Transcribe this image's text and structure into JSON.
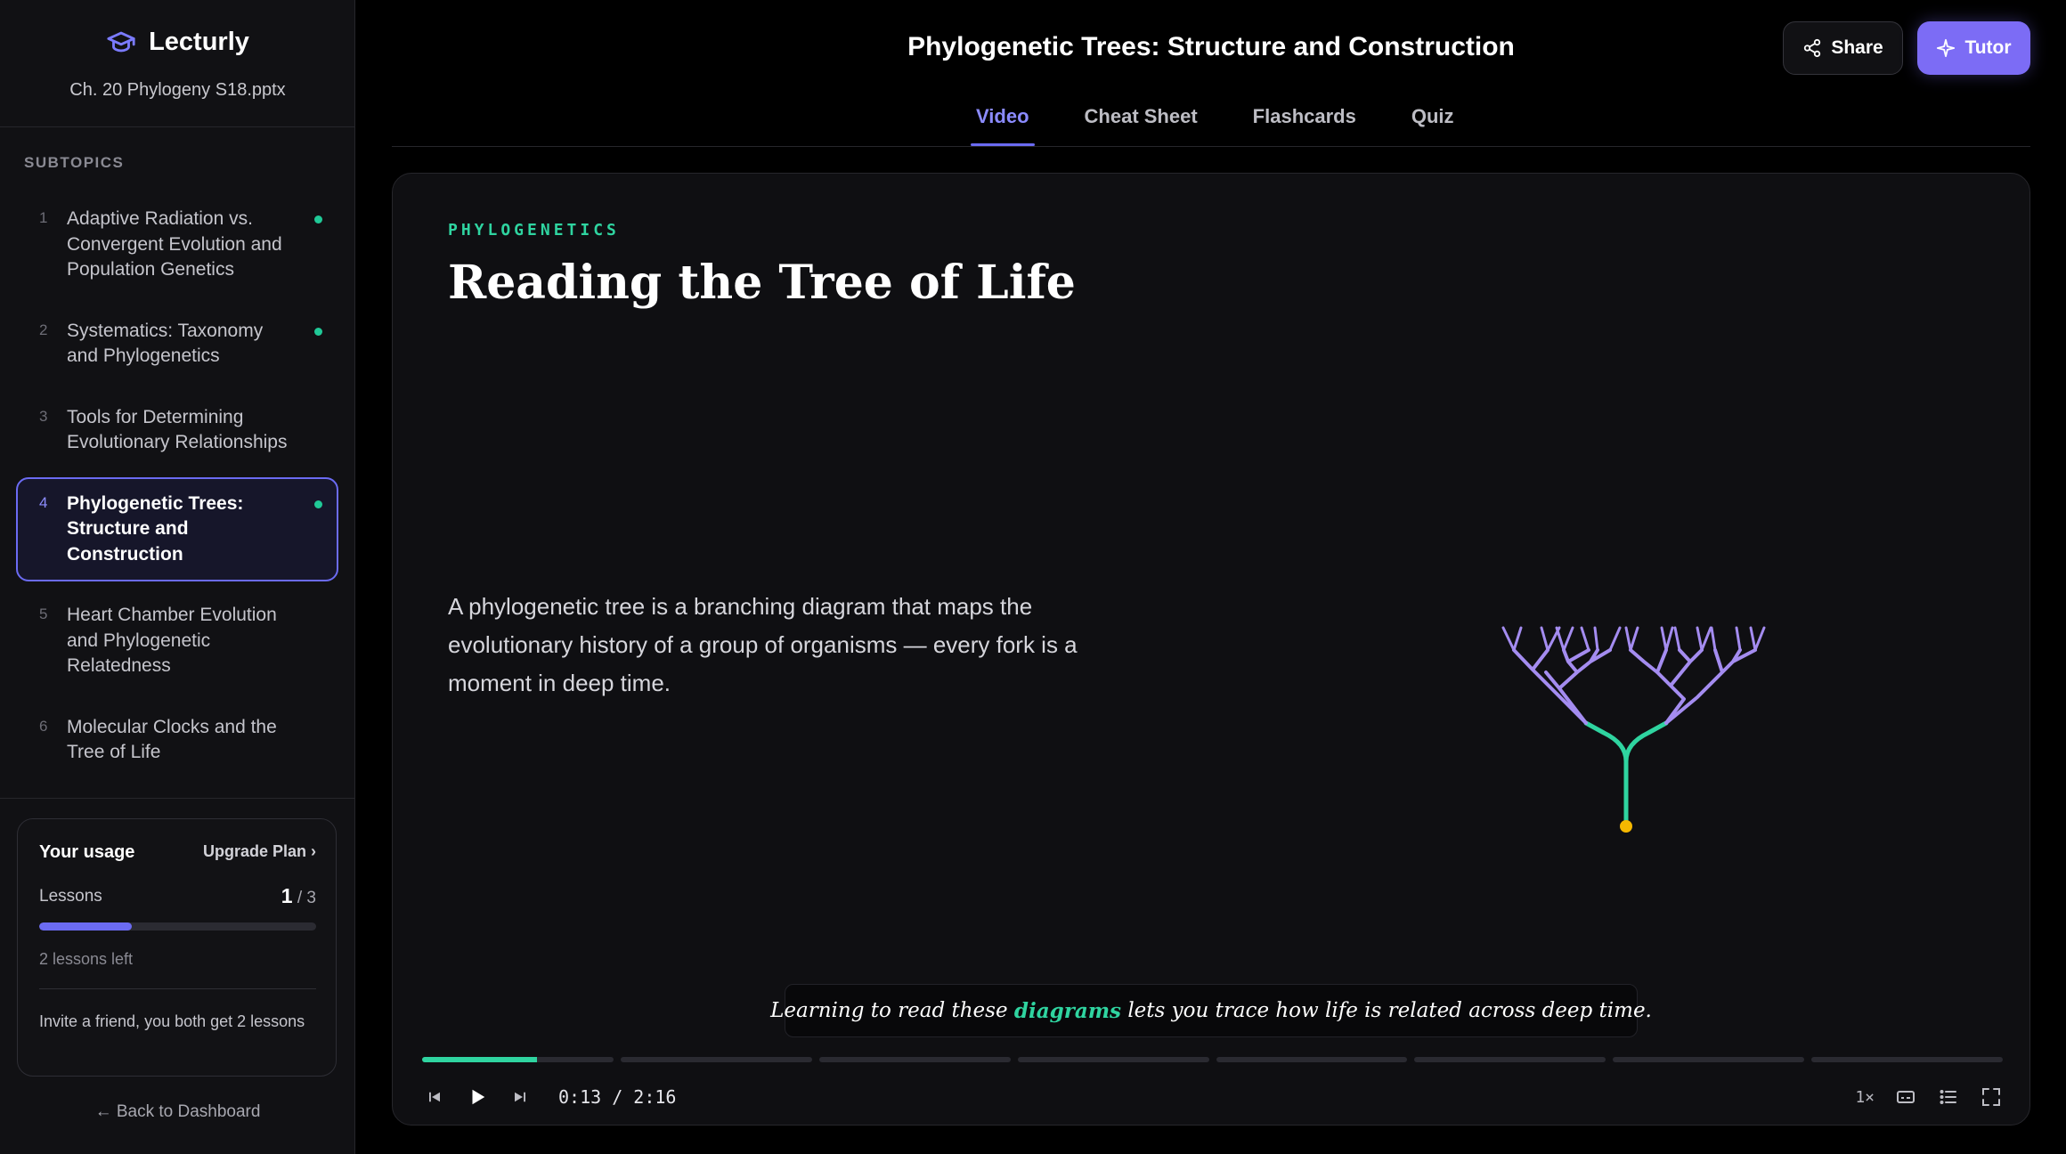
{
  "sidebar": {
    "brand": "Lecturly",
    "file_name": "Ch. 20 Phylogeny S18.pptx",
    "subtopics_heading": "SUBTOPICS",
    "items": [
      {
        "num": "1",
        "title": "Adaptive Radiation vs. Convergent Evolution and Population Genetics",
        "completed": true,
        "active": false
      },
      {
        "num": "2",
        "title": "Systematics: Taxonomy and Phylogenetics",
        "completed": true,
        "active": false
      },
      {
        "num": "3",
        "title": "Tools for Determining Evolutionary Relationships",
        "completed": false,
        "active": false
      },
      {
        "num": "4",
        "title": "Phylogenetic Trees: Structure and Construction",
        "completed": true,
        "active": true
      },
      {
        "num": "5",
        "title": "Heart Chamber Evolution and Phylogenetic Relatedness",
        "completed": false,
        "active": false
      },
      {
        "num": "6",
        "title": "Molecular Clocks and the Tree of Life",
        "completed": false,
        "active": false
      }
    ],
    "usage": {
      "title": "Your usage",
      "upgrade_label": "Upgrade Plan ›",
      "lessons_label": "Lessons",
      "lessons_used": "1",
      "lessons_total": "/ 3",
      "progress_fraction": 0.333,
      "lessons_left": "2 lessons left",
      "invite_text": "Invite a friend, you both get 2 lessons"
    },
    "back_link": "← Back to Dashboard"
  },
  "header": {
    "title": "Phylogenetic Trees: Structure and Construction",
    "share_label": "Share",
    "tutor_label": "Tutor",
    "tabs": [
      {
        "label": "Video",
        "active": true
      },
      {
        "label": "Cheat Sheet",
        "active": false
      },
      {
        "label": "Flashcards",
        "active": false
      },
      {
        "label": "Quiz",
        "active": false
      }
    ]
  },
  "slide": {
    "eyebrow": "PHYLOGENETICS",
    "heading": "Reading the Tree of Life",
    "body": "A phylogenetic tree is a branching diagram that maps the evolutionary history of a group of organisms — every fork is a moment in deep time.",
    "caption_before": "Learning to read these ",
    "caption_highlight": "diagrams",
    "caption_after": " lets you trace how life is related across deep time."
  },
  "player": {
    "time": "0:13 / 2:16",
    "speed": "1×",
    "segment_progress": [
      0.6,
      0,
      0,
      0,
      0,
      0,
      0,
      0
    ]
  },
  "colors": {
    "accent": "#6b6bf2",
    "tutor_button": "#7c6cf5",
    "teal": "#2fd4a0",
    "tree_branch": "#a48cf0",
    "tree_root": "#f5b800",
    "completed_dot": "#20c997"
  },
  "icons": {
    "brand": "graduation-cap-icon",
    "share": "share-icon",
    "tutor": "sparkle-icon",
    "prev": "skip-back-icon",
    "play": "play-icon",
    "next": "skip-forward-icon",
    "captions": "captions-icon",
    "chapters": "list-icon",
    "fullscreen": "fullscreen-icon"
  }
}
